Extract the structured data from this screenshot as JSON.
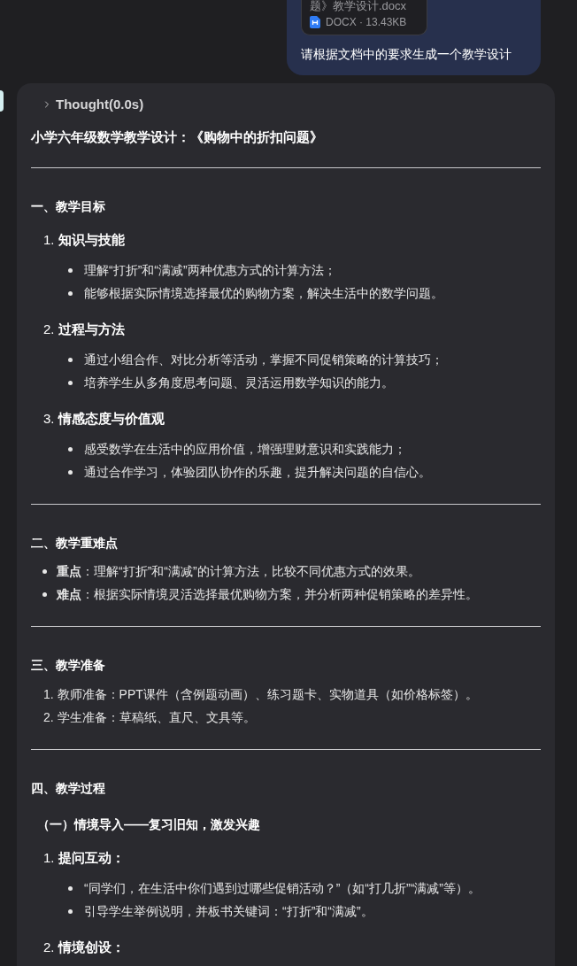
{
  "user_message": {
    "attachment": {
      "file_name": "题》教学设计.docx",
      "file_meta": "DOCX · 13.43KB"
    },
    "text": "请根据文档中的要求生成一个教学设计"
  },
  "response": {
    "thought": {
      "label": "Thought(0.0s)",
      "expanded": false
    },
    "title": "小学六年级数学教学设计：《购物中的折扣问题》",
    "sections": [
      {
        "heading": "一、教学目标",
        "blocks": [
          {
            "kind": "numbered",
            "items": [
              {
                "number": "1.",
                "title": "知识与技能",
                "bullets": [
                  "理解“打折”和“满减”两种优惠方式的计算方法；",
                  "能够根据实际情境选择最优的购物方案，解决生活中的数学问题。"
                ]
              },
              {
                "number": "2.",
                "title": "过程与方法",
                "bullets": [
                  "通过小组合作、对比分析等活动，掌握不同促销策略的计算技巧；",
                  "培养学生从多角度思考问题、灵活运用数学知识的能力。"
                ]
              },
              {
                "number": "3.",
                "title": "情感态度与价值观",
                "bullets": [
                  "感受数学在生活中的应用价值，增强理财意识和实践能力；",
                  "通过合作学习，体验团队协作的乐趣，提升解决问题的自信心。"
                ]
              }
            ]
          }
        ]
      },
      {
        "heading": "二、教学重难点",
        "blocks": [
          {
            "kind": "bullets",
            "items": [
              "**重点**：理解“打折”和“满减”的计算方法，比较不同优惠方式的效果。",
              "**难点**：根据实际情境灵活选择最优购物方案，并分析两种促销策略的差异性。"
            ]
          }
        ]
      },
      {
        "heading": "三、教学准备",
        "blocks": [
          {
            "kind": "ordered",
            "items": [
              {
                "number": "1.",
                "text": "教师准备：PPT课件（含例题动画）、练习题卡、实物道具（如价格标签）。"
              },
              {
                "number": "2.",
                "text": "学生准备：草稿纸、直尺、文具等。"
              }
            ]
          }
        ]
      },
      {
        "heading": "四、教学过程",
        "blocks": [
          {
            "kind": "subheading",
            "text": "（一）情境导入——复习旧知，激发兴趣"
          },
          {
            "kind": "numbered",
            "items": [
              {
                "number": "1.",
                "title": "提问互动：",
                "bullets": [
                  "“同学们，在生活中你们遇到过哪些促销活动？”（如“打几折”“满减”等）。",
                  "引导学生举例说明，并板书关键词：“打折”和“满减”。"
                ]
              },
              {
                "number": "2.",
                "title": "情境创设："
              }
            ]
          }
        ]
      }
    ]
  }
}
